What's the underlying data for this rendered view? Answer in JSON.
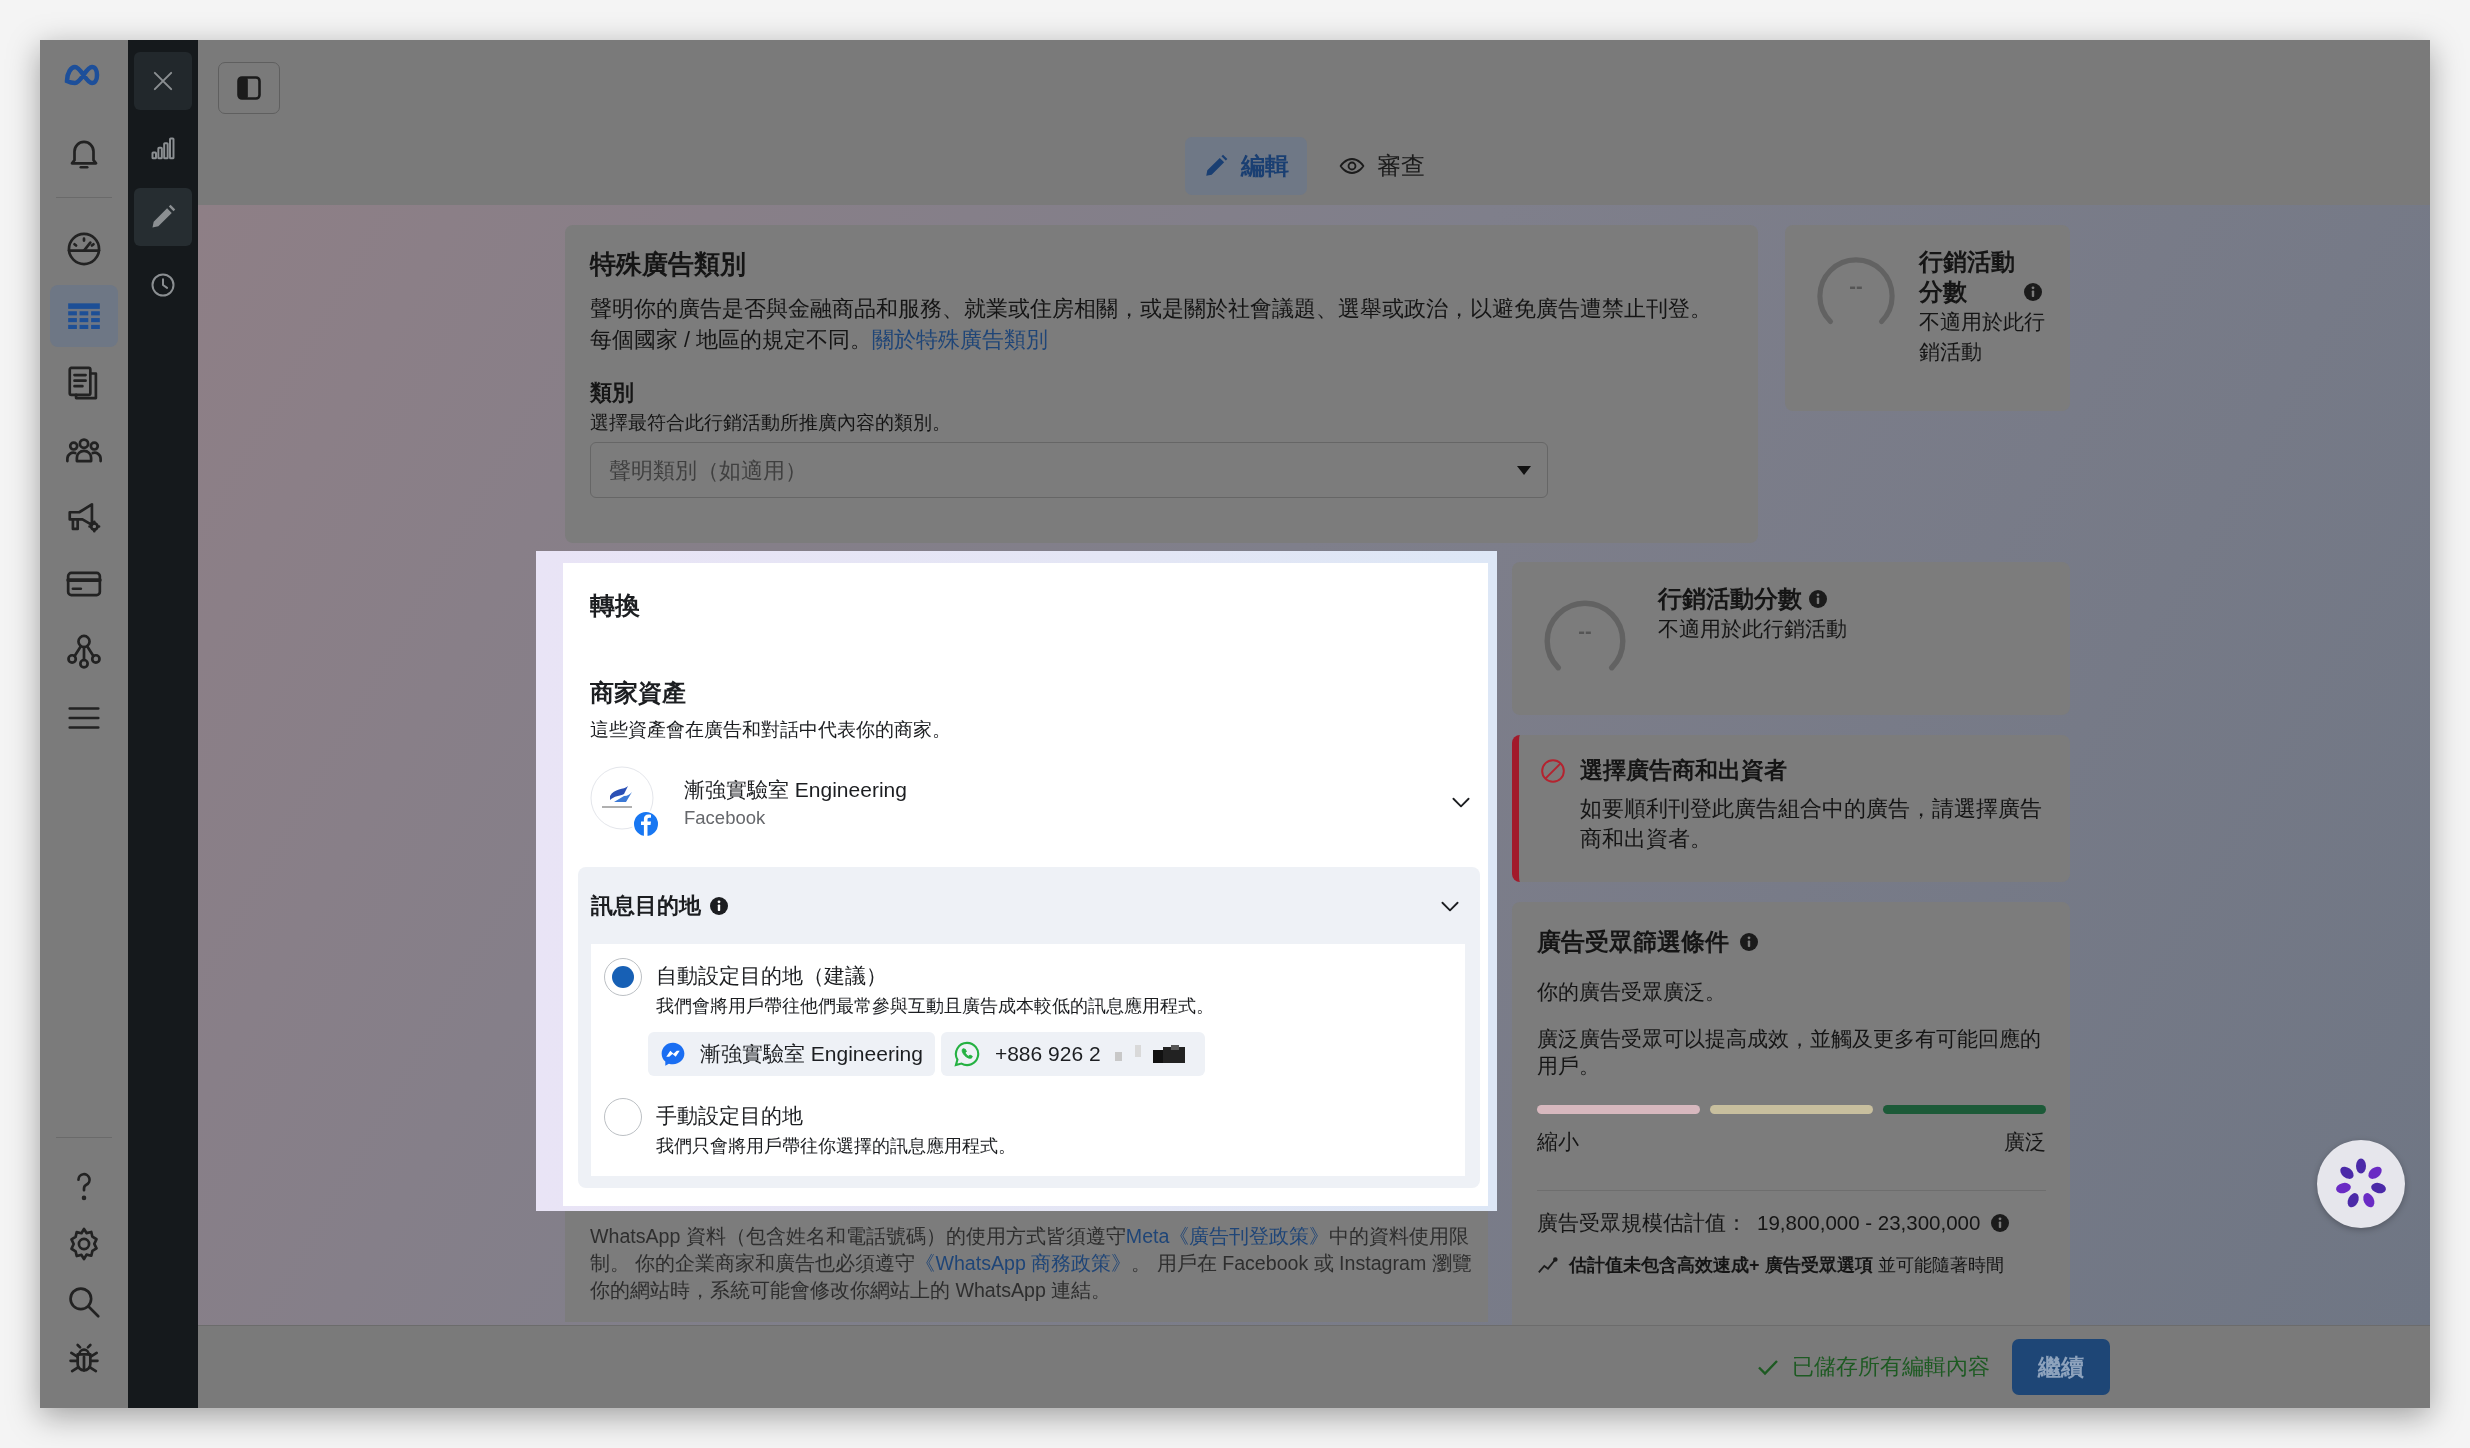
{
  "nav_rail": {
    "items": [
      {
        "selected": false
      },
      {
        "selected": false
      },
      {
        "selected": true
      },
      {
        "selected": false
      },
      {
        "selected": false
      },
      {
        "selected": false
      },
      {
        "selected": false
      },
      {
        "selected": false
      },
      {
        "selected": false
      }
    ],
    "bottom_items": [
      {
        "selected": false
      },
      {
        "selected": false
      },
      {
        "selected": false
      },
      {
        "selected": false
      }
    ]
  },
  "tool_rail": {
    "items": [
      {
        "selected": false
      },
      {
        "selected": true
      },
      {
        "selected": false
      }
    ]
  },
  "view_tabs": [
    {
      "label": "編輯",
      "selected": true
    },
    {
      "label": "審查",
      "selected": false
    }
  ],
  "special_ad_category": {
    "title": "特殊廣告類別",
    "description": "聲明你的廣告是否與金融商品和服務、就業或住房相關，或是關於社會議題、選舉或政治，以避免廣告遭禁止刊登。每個國家 / 地區的規定不同。",
    "link": "關於特殊廣告類別",
    "category_label": "類別",
    "category_hint": "選擇最符合此行銷活動所推廣內容的類別。",
    "select": {
      "placeholder": "聲明類別（如適用）"
    }
  },
  "score_small": {
    "title": "行銷活動分數",
    "gauge_value": "--",
    "status": "不適用於此行銷活動"
  },
  "conversion": {
    "title": "轉換",
    "business_assets": {
      "title": "商家資產",
      "description": "這些資產會在廣告和對話中代表你的商家。",
      "page": {
        "name": "漸強實驗室 Engineering",
        "platform": "Facebook"
      }
    },
    "message_destination": {
      "title": "訊息目的地",
      "expanded": true,
      "options": [
        {
          "label": "自動設定目的地（建議）",
          "description": "我們會將用戶帶往他們最常參與互動且廣告成本較低的訊息應用程式。",
          "selected": true,
          "apps": [
            {
              "kind": "messenger",
              "label": "漸強實驗室 Engineering"
            },
            {
              "kind": "whatsapp",
              "label": "+886 926 2"
            }
          ]
        },
        {
          "label": "手動設定目的地",
          "description": "我們只會將用戶帶往你選擇的訊息應用程式。",
          "selected": false
        }
      ]
    },
    "footer_note": [
      {
        "text": "WhatsApp 資料（包含姓名和電話號碼）的使用方式皆須遵守"
      },
      {
        "link": "Meta《廣告刊登政策》"
      },
      {
        "text": "中的資料使用限制。 你的企業商家和廣告也必須遵守"
      },
      {
        "link": "《WhatsApp 商務政策》"
      },
      {
        "text": "。 用戶在 Facebook 或 Instagram 瀏覽你的網站時，系統可能會修改你網站上的 WhatsApp 連結。"
      }
    ]
  },
  "campaign_score": {
    "title": "行銷活動分數",
    "gauge_value": "--",
    "status": "不適用於此行銷活動"
  },
  "warning": {
    "title": "選擇廣告商和出資者",
    "message": "如要順利刊登此廣告組合中的廣告，請選擇廣告商和出資者。"
  },
  "audience_definition": {
    "title": "廣告受眾篩選條件",
    "summary": "你的廣告受眾廣泛。",
    "detail": "廣泛廣告受眾可以提高成效，並觸及更多有可能回應的用戶。",
    "meter": {
      "segments": [
        {
          "color": "#d7b8be"
        },
        {
          "color": "#c8bf9e"
        },
        {
          "color": "#1c5a38"
        }
      ],
      "min_label": "縮小",
      "max_label": "廣泛"
    },
    "estimate_label": "廣告受眾規模估計值：",
    "estimate": "19,800,000 - 23,300,000",
    "note": "**估計值未包含高效速成+ 廣告受眾選項** 並可能隨著時間"
  },
  "footer": {
    "save_status": "已儲存所有編輯內容",
    "continue_button": "繼續"
  }
}
